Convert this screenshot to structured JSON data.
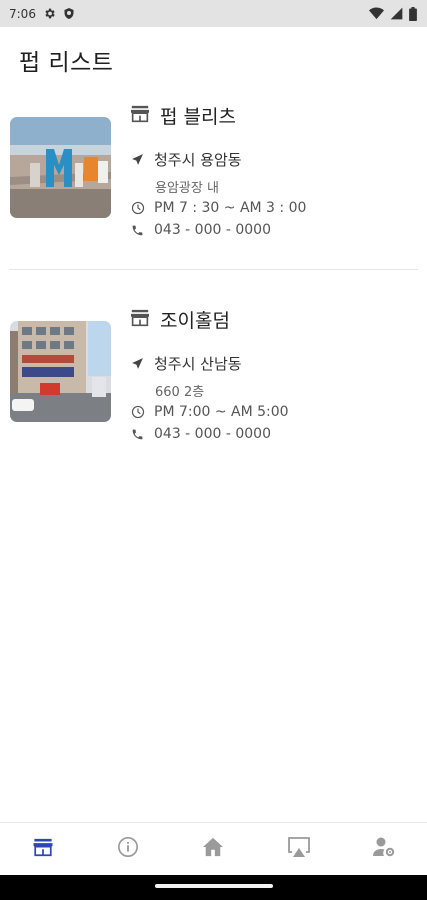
{
  "status_bar": {
    "time": "7:06",
    "icons": [
      "gear-icon",
      "shield-icon",
      "wifi-icon",
      "signal-icon",
      "battery-icon"
    ]
  },
  "header": {
    "title": "펍 리스트"
  },
  "pubs": [
    {
      "name": "펍 블리츠",
      "address": "청주시 용암동",
      "address_detail": "용암광장 내",
      "hours": "PM 7 : 30 ~ AM 3 : 00",
      "phone": "043 - 000 - 0000"
    },
    {
      "name": "조이홀덤",
      "address": "청주시 산남동",
      "address_detail": "660 2층",
      "hours": "PM 7:00 ~ AM 5:00",
      "phone": "043 - 000 - 0000"
    }
  ],
  "bottom_nav": {
    "items": [
      {
        "icon": "store-icon",
        "active": true
      },
      {
        "icon": "info-icon",
        "active": false
      },
      {
        "icon": "home-icon",
        "active": false
      },
      {
        "icon": "airplay-icon",
        "active": false
      },
      {
        "icon": "user-settings-icon",
        "active": false
      }
    ]
  },
  "colors": {
    "active": "#2f46b5",
    "inactive": "#9a9a9a",
    "status_bar": "#e3e3e3"
  }
}
